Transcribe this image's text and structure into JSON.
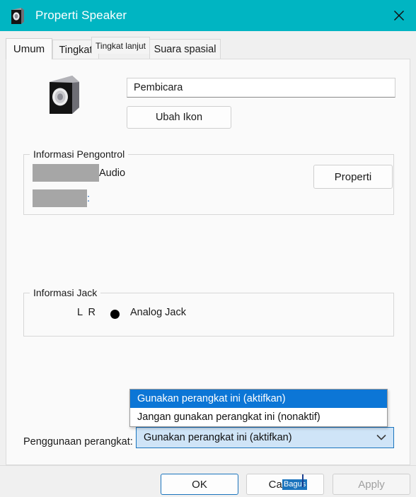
{
  "window": {
    "title": "Properti Speaker",
    "title_icon": "speaker-icon",
    "close_icon": "close-icon",
    "titlebar_color": "#00b5c2"
  },
  "tabs": [
    {
      "label": "Umum",
      "active": true
    },
    {
      "label": "Tingkat",
      "active": false
    },
    {
      "label": "Tingkat lanjut",
      "active": false
    },
    {
      "label": "Suara spasial",
      "active": false
    }
  ],
  "general": {
    "device_icon": "speaker-device-icon",
    "name_value": "Pembicara",
    "name_placeholder": "Pembicara",
    "change_icon_label": "Ubah Ikon"
  },
  "controller_group": {
    "title": "Informasi Pengontrol",
    "line1_suffix": "Audio",
    "line2_suffix": ":",
    "redacted_line1": "",
    "redacted_line2": "",
    "properties_label": "Properti"
  },
  "jack_group": {
    "title": "Informasi Jack",
    "channels": "L R",
    "jack_indicator": "jack-dot-icon",
    "jack_label": "Analog Jack"
  },
  "device_usage": {
    "label": "Penggunaan perangkat:",
    "selected": "Gunakan perangkat ini (aktifkan)",
    "chevron_icon": "chevron-down-icon",
    "open": true,
    "options": [
      {
        "label": "Gunakan perangkat ini (aktifkan)",
        "selected": true
      },
      {
        "label": "Jangan gunakan perangkat ini (nonaktif)",
        "selected": false
      }
    ],
    "highlight_color": "#0c76d6",
    "field_color": "#cfe4f7"
  },
  "footer": {
    "ok_label": "OK",
    "cancel_label": "Cancel",
    "apply_label": "Apply",
    "apply_disabled": true,
    "default_button": "OK"
  },
  "overlay": {
    "ime_text": "Bagus"
  }
}
